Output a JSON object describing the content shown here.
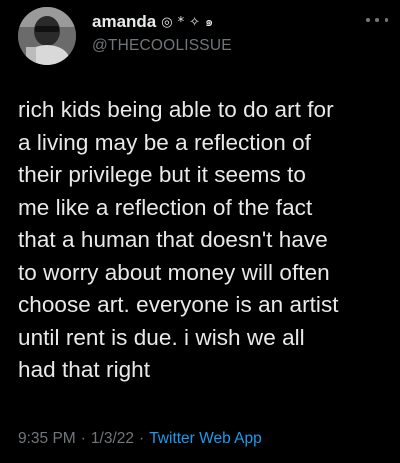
{
  "user": {
    "display_name": "amanda",
    "badges": [
      "◎",
      "*",
      "✧",
      "๑"
    ],
    "handle": "@THECOOLISSUE"
  },
  "tweet": {
    "lines": [
      "rich kids being able to do art for",
      "a living may be a reflection of",
      "their privilege but it seems to",
      "me like a reflection of the fact",
      "that a human that doesn't have",
      "to worry about money will often",
      "choose art. everyone is an artist",
      "until rent is due. i wish we all",
      "had that right"
    ]
  },
  "meta": {
    "time": "9:35 PM",
    "separator": "·",
    "date": "1/3/22",
    "source": "Twitter Web App"
  },
  "icons": {
    "more": "more-options-icon"
  },
  "colors": {
    "background": "#000000",
    "text": "#e7e9ea",
    "muted": "#71767b",
    "link": "#1d9bf0"
  }
}
